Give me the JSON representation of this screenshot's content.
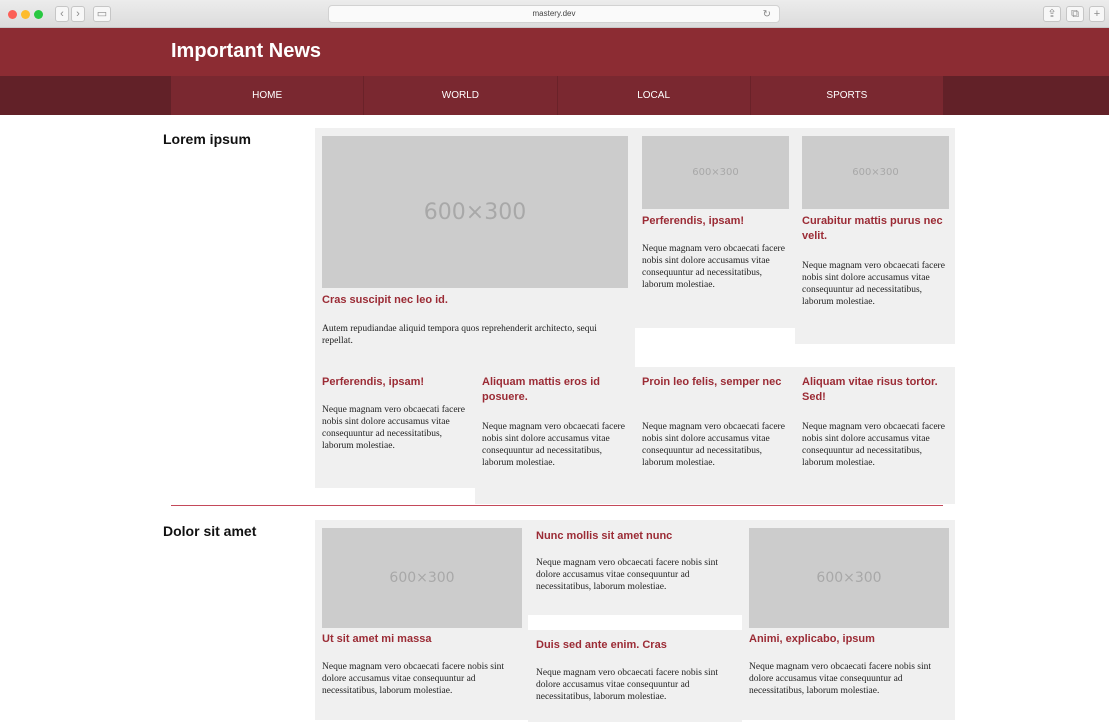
{
  "browser": {
    "url": "mastery.dev"
  },
  "site": {
    "title": "Important News"
  },
  "nav": {
    "items": [
      "HOME",
      "WORLD",
      "LOCAL",
      "SPORTS"
    ]
  },
  "placeholder_label": "600×300",
  "section1": {
    "title": "Lorem ipsum",
    "featured": {
      "heading": "Cras suscipit nec leo id.",
      "text": "Autem repudiandae aliquid tempora quos reprehenderit architecto, sequi repellat."
    },
    "top_right": [
      {
        "heading": "Perferendis, ipsam!",
        "text": "Neque magnam vero obcaecati facere nobis sint dolore accusamus vitae consequuntur ad necessitatibus, laborum molestiae."
      },
      {
        "heading": "Curabitur mattis purus nec velit.",
        "text": "Neque magnam vero obcaecati facere nobis sint dolore accusamus vitae consequuntur ad necessitatibus, laborum molestiae."
      }
    ],
    "bottom_row": [
      {
        "heading": "Perferendis, ipsam!",
        "text": "Neque magnam vero obcaecati facere nobis sint dolore accusamus vitae consequuntur ad necessitatibus, laborum molestiae."
      },
      {
        "heading": "Aliquam mattis eros id posuere.",
        "text": "Neque magnam vero obcaecati facere nobis sint dolore accusamus vitae consequuntur ad necessitatibus, laborum molestiae."
      },
      {
        "heading": "Proin leo felis, semper nec",
        "text": "Neque magnam vero obcaecati facere nobis sint dolore accusamus vitae consequuntur ad necessitatibus, laborum molestiae."
      },
      {
        "heading": "Aliquam vitae risus tortor. Sed!",
        "text": "Neque magnam vero obcaecati facere nobis sint dolore accusamus vitae consequuntur ad necessitatibus, laborum molestiae."
      }
    ]
  },
  "section2": {
    "title": "Dolor sit amet",
    "cards": [
      {
        "heading": "Ut sit amet mi massa",
        "text": "Neque magnam vero obcaecati facere nobis sint dolore accusamus vitae consequuntur ad necessitatibus, laborum molestiae."
      },
      {
        "heading": "Nunc mollis sit amet nunc",
        "text": "Neque magnam vero obcaecati facere nobis sint dolore accusamus vitae consequuntur ad necessitatibus, laborum molestiae."
      },
      {
        "heading": "Duis sed ante enim. Cras",
        "text": "Neque magnam vero obcaecati facere nobis sint dolore accusamus vitae consequuntur ad necessitatibus, laborum molestiae."
      },
      {
        "heading": "Animi, explicabo, ipsum",
        "text": "Neque magnam vero obcaecati facere nobis sint dolore accusamus vitae consequuntur ad necessitatibus, laborum molestiae."
      }
    ]
  },
  "colors": {
    "brand": "#8c2c33",
    "nav": "#7a2830",
    "accent_text": "#9b2b35"
  }
}
